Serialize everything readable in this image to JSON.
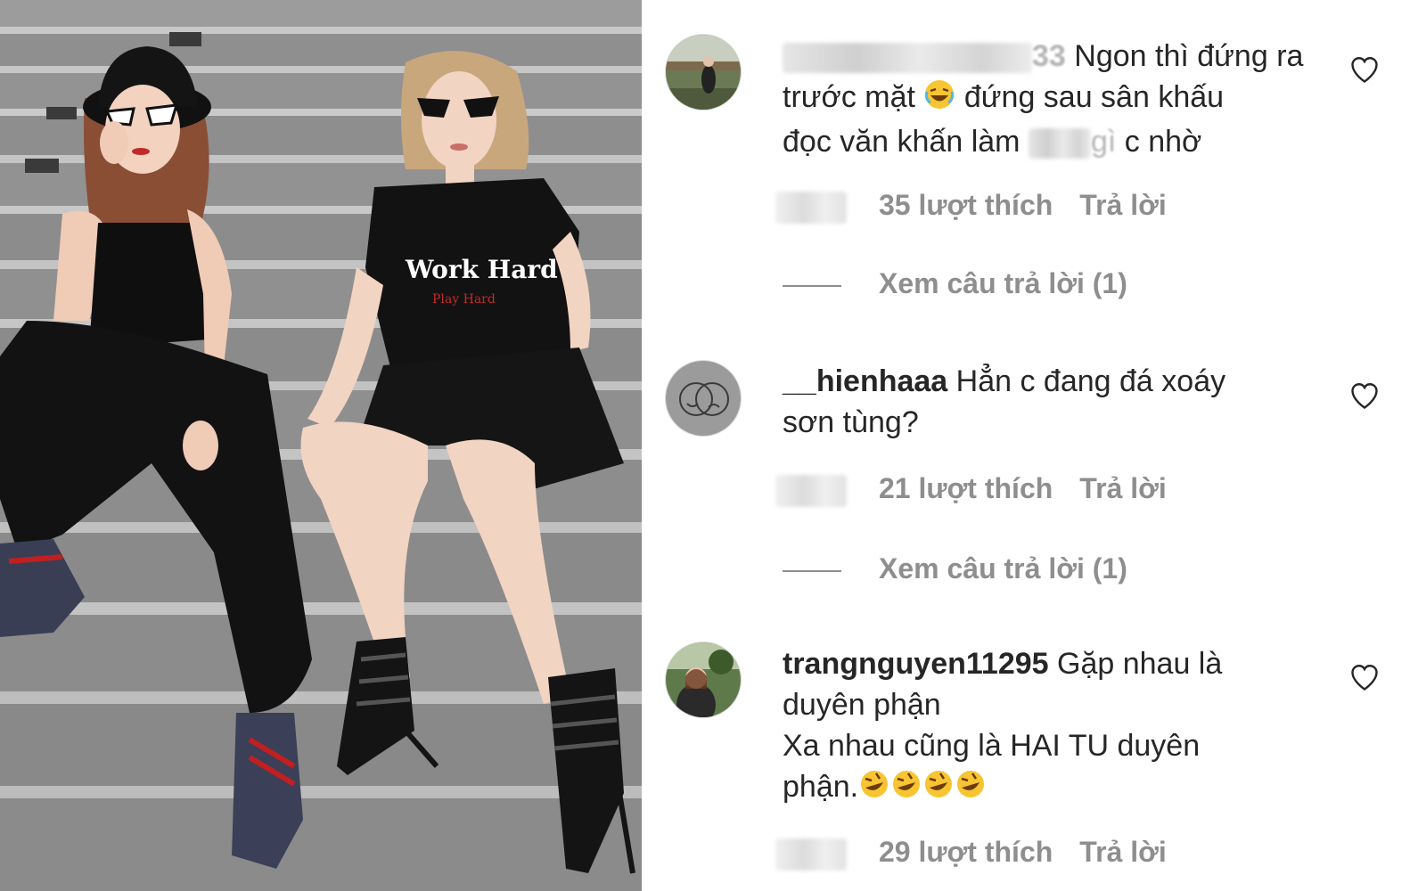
{
  "photo": {
    "shirt_text_main": "Work Hard",
    "shirt_text_sub": "Play Hard"
  },
  "comments": [
    {
      "username_suffix": "33",
      "text_line1": "Ngon thì đứng ra",
      "text_line2": "trước mặt",
      "text_line2b": "đứng sau sân khấu",
      "text_line3a": "đọc văn khấn làm",
      "text_line3b": "gì",
      "text_line3c": "c nhờ",
      "likes": "35 lượt thích",
      "reply": "Trả lời",
      "view_replies": "Xem câu trả lời (1)",
      "icon": "heart-icon"
    },
    {
      "username": "__hienhaaa",
      "text_line1": "Hẳn c đang đá xoáy",
      "text_line2": "sơn tùng?",
      "likes": "21 lượt thích",
      "reply": "Trả lời",
      "view_replies": "Xem câu trả lời (1)",
      "icon": "heart-icon"
    },
    {
      "username": "trangnguyen11295",
      "text_line1": "Gặp nhau là",
      "text_line2": "duyên phận",
      "text_line3": "Xa nhau cũng là HAI TU duyên",
      "text_line4": "phận.",
      "likes": "29 lượt thích",
      "reply": "Trả lời",
      "icon": "heart-icon"
    }
  ],
  "colors": {
    "text": "#262626",
    "secondary": "#8e8e8e",
    "border": "#dbdbdb"
  }
}
